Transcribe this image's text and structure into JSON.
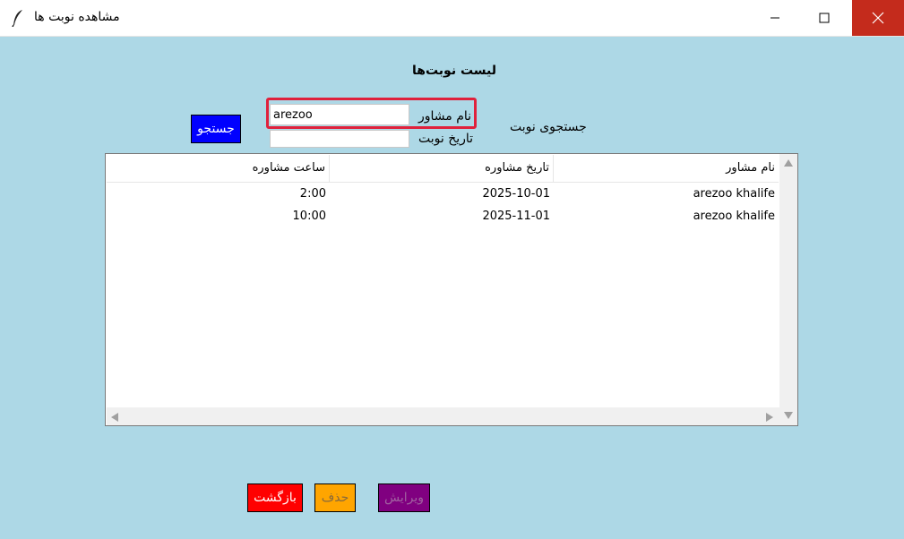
{
  "window": {
    "title": "مشاهده نوبت ها",
    "controls": {
      "minimize": "minimize-icon",
      "maximize": "maximize-icon",
      "close": "close-icon"
    }
  },
  "page": {
    "heading": "لیست نوبت‌ها",
    "search_section_label": "جستجوی نوبت"
  },
  "search": {
    "name_label": "نام مشاور",
    "name_value": "arezoo",
    "date_label": "تاریخ نوبت",
    "date_value": "",
    "button_label": "جستجو"
  },
  "table": {
    "columns": [
      "ساعت مشاوره",
      "تاریخ مشاوره",
      "نام مشاور"
    ],
    "rows": [
      {
        "time": "2:00",
        "date": "2025-10-01",
        "name": "arezoo khalife"
      },
      {
        "time": "10:00",
        "date": "2025-11-01",
        "name": "arezoo khalife"
      }
    ]
  },
  "actions": {
    "back_label": "بازگشت",
    "delete_label": "حذف",
    "edit_label": "ویرایش"
  },
  "colors": {
    "background": "#add8e6",
    "search_button": "#0000ff",
    "back_button": "#ff0000",
    "delete_button": "#ffa500",
    "edit_button": "#800080",
    "highlight_box": "#e0213c",
    "close_button": "#c42b1c"
  }
}
